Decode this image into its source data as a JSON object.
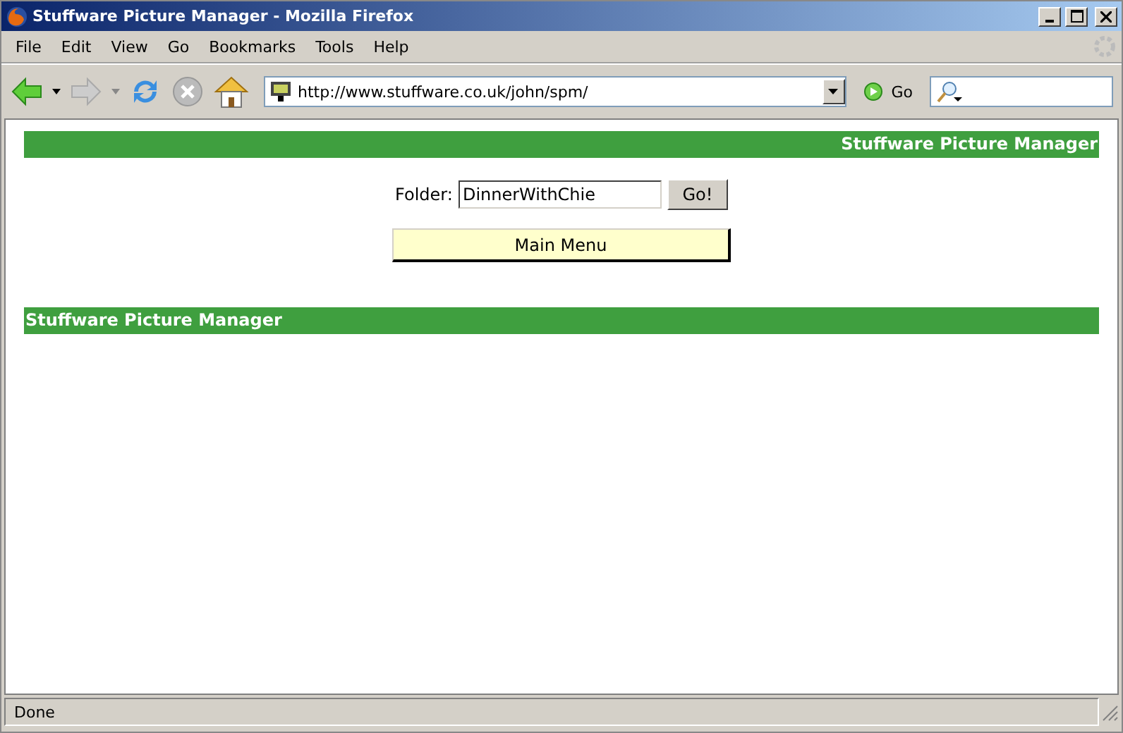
{
  "window": {
    "title": "Stuffware Picture Manager - Mozilla Firefox"
  },
  "menu": [
    "File",
    "Edit",
    "View",
    "Go",
    "Bookmarks",
    "Tools",
    "Help"
  ],
  "toolbar": {
    "address": "http://www.stuffware.co.uk/john/spm/",
    "go_label": "Go"
  },
  "page": {
    "header": "Stuffware Picture Manager",
    "folder_label": "Folder:",
    "folder_value": "DinnerWithChie",
    "go_button": "Go!",
    "main_menu": "Main Menu",
    "footer": "Stuffware Picture Manager"
  },
  "status_bar": {
    "text": "Done"
  }
}
